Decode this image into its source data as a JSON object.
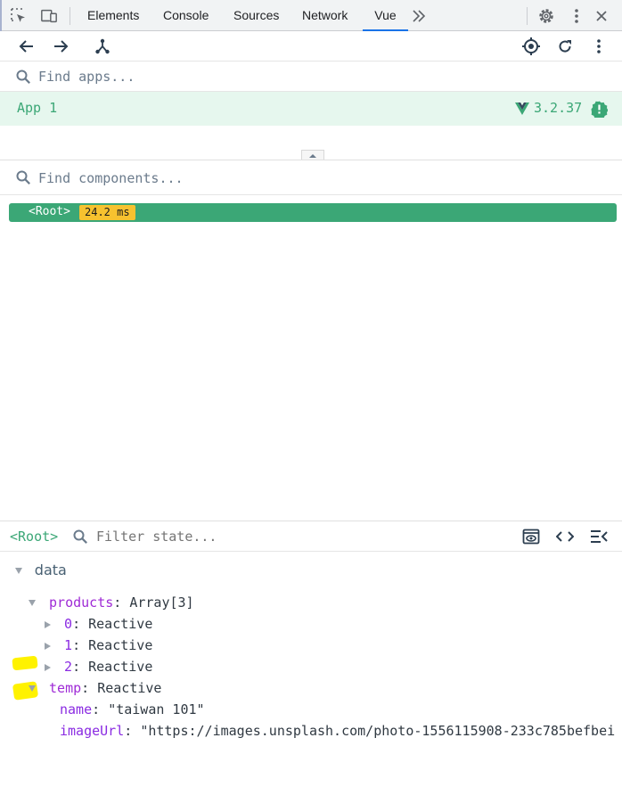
{
  "devtools": {
    "tabs": [
      "Elements",
      "Console",
      "Sources",
      "Network",
      "Vue"
    ],
    "active_tab": "Vue",
    "more_tabs_icon": "double-chevron-right-icon",
    "left_icons": [
      "inspect-element-icon",
      "device-toolbar-icon"
    ],
    "right_icons": [
      "gear-icon",
      "more-vertical-icon",
      "close-icon"
    ]
  },
  "vue_toolbar": {
    "left_icons": [
      "arrow-left-icon",
      "arrow-right-icon",
      "component-tree-icon"
    ],
    "right_icons": [
      "target-icon",
      "refresh-icon",
      "more-vertical-icon"
    ]
  },
  "apps": {
    "search_placeholder": "Find apps...",
    "items": [
      {
        "name": "App 1",
        "version": "3.2.37"
      }
    ]
  },
  "components": {
    "search_placeholder": "Find components...",
    "root": {
      "name": "<Root>",
      "time": "24.2 ms"
    }
  },
  "inspector": {
    "selected": "<Root>",
    "filter_placeholder": "Filter state...",
    "section": "data",
    "products_key": "products",
    "products_value": "Array[3]",
    "product_items": [
      {
        "index": "0",
        "value": "Reactive"
      },
      {
        "index": "1",
        "value": "Reactive"
      },
      {
        "index": "2",
        "value": "Reactive"
      }
    ],
    "temp_key": "temp",
    "temp_value": "Reactive",
    "temp_fields": [
      {
        "key": "name",
        "value": "\"taiwan 101\""
      },
      {
        "key": "imageUrl",
        "value": "\"https://images.unsplash.com/photo-1556115908-233c785befbei"
      }
    ]
  },
  "colors": {
    "vue_green": "#3ba776",
    "timing_badge": "#f7c22f",
    "highlight": "#fff200",
    "active_tab_underline": "#1a73e8"
  }
}
